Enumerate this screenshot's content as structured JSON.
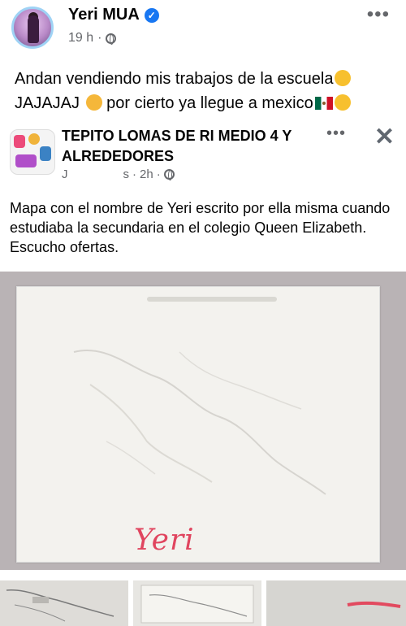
{
  "post": {
    "author": "Yeri MUA",
    "time": "19 h",
    "separator": "·",
    "menu": "•••",
    "caption_line1": "Andan vendiendo mis trabajos de la escuela",
    "caption_line2a": "JAJAJAJ",
    "caption_line2b": " por cierto ya llegue a mexico"
  },
  "shared": {
    "group_name": "TEPITO LOMAS DE RI      MEDIO 4 Y ALREDEDORES",
    "author_partial": "J",
    "time_prefix": "s",
    "time": "2h",
    "separator": "·",
    "menu": "•••",
    "close": "✕",
    "text": "Mapa con el nombre de Yeri escrito por ella misma cuando estudiaba la secundaria en el colegio Queen Elizabeth. Escucho ofertas.",
    "photo_signature": "Yeri"
  },
  "icons": [
    "verified-icon",
    "globe-icon",
    "more-icon",
    "close-icon",
    "emoji-grin-icon",
    "emoji-flushed-icon",
    "mexico-flag-icon",
    "emoji-love-icon"
  ],
  "colors": {
    "verified": "#1877f2",
    "meta": "#65676b",
    "signature": "#e0455f"
  }
}
